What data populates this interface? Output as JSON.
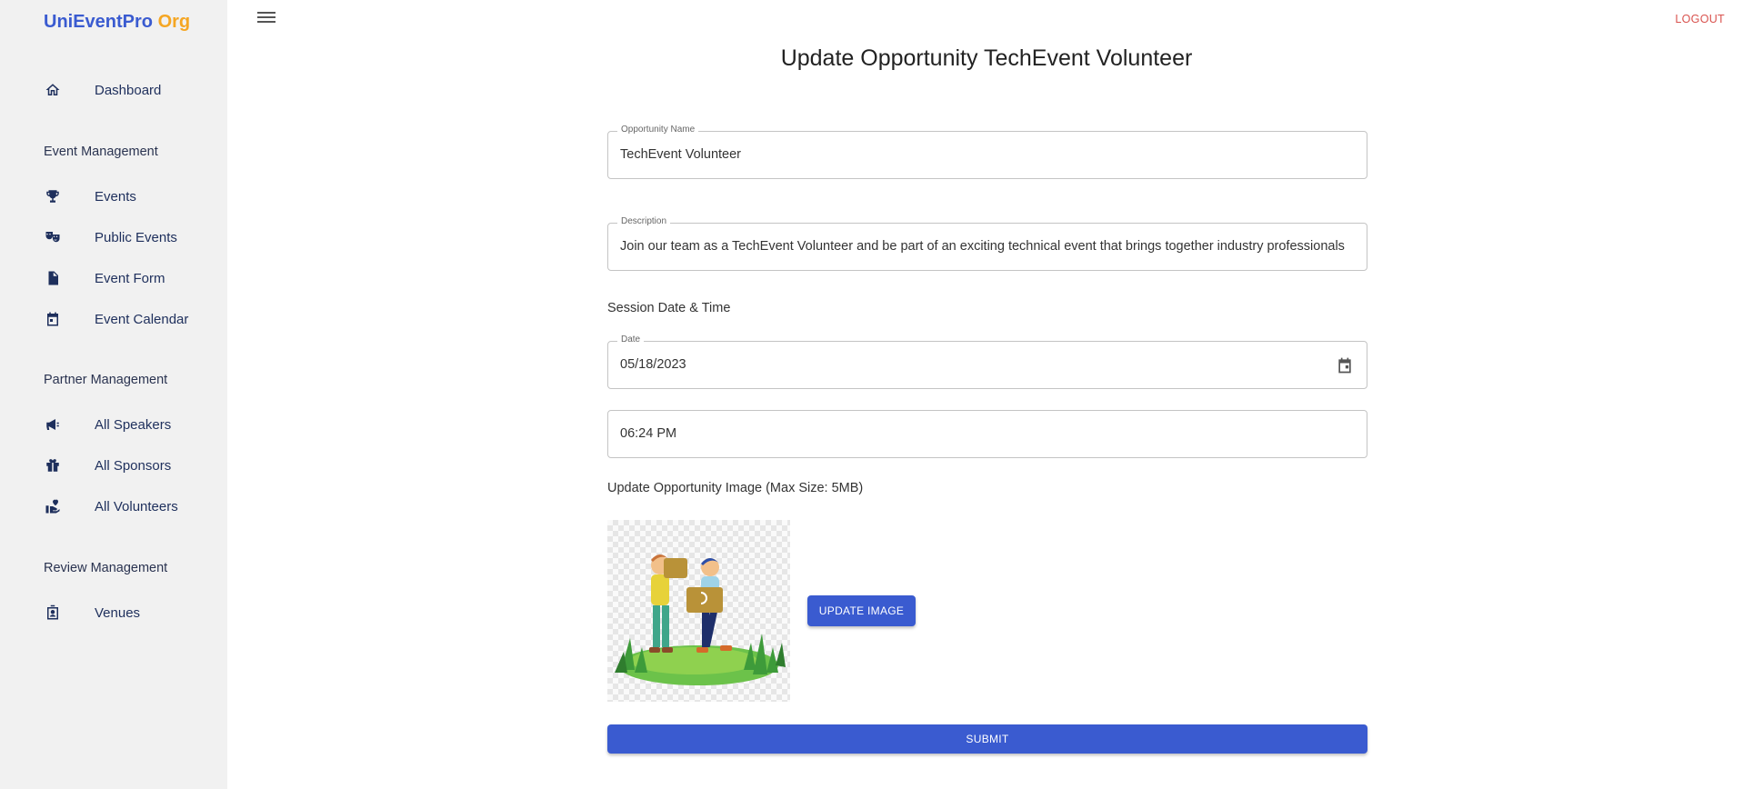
{
  "brand": {
    "name": "UniEventPro",
    "suffix": "Org",
    "primary_color": "#3a5bd0",
    "accent_color": "#f5a623"
  },
  "sidebar": {
    "items": [
      {
        "label": "Dashboard",
        "icon": "home-icon"
      },
      {
        "label": "Events",
        "icon": "trophy-icon"
      },
      {
        "label": "Public Events",
        "icon": "theater-masks-icon"
      },
      {
        "label": "Event Form",
        "icon": "document-icon"
      },
      {
        "label": "Event Calendar",
        "icon": "calendar-icon"
      },
      {
        "label": "All Speakers",
        "icon": "megaphone-icon"
      },
      {
        "label": "All Sponsors",
        "icon": "gift-box-icon"
      },
      {
        "label": "All Volunteers",
        "icon": "volunteer-hand-icon"
      },
      {
        "label": "Venues",
        "icon": "contact-badge-icon"
      }
    ],
    "sections": {
      "event": "Event Management",
      "partner": "Partner Management",
      "review": "Review Management"
    }
  },
  "header": {
    "logout_label": "LOGOUT",
    "logout_color": "#d9534f"
  },
  "main": {
    "title": "Update Opportunity TechEvent Volunteer",
    "opportunity_name": {
      "label": "Opportunity Name",
      "value": "TechEvent Volunteer"
    },
    "description": {
      "label": "Description",
      "value": "Join our team as a TechEvent Volunteer and be part of an exciting technical event that brings together industry professionals"
    },
    "session_label": "Session Date & Time",
    "date": {
      "label": "Date",
      "value": "05/18/2023"
    },
    "time": {
      "value": "06:24 PM"
    },
    "image_label": "Update Opportunity Image (Max Size: 5MB)",
    "update_image_button": "UPDATE IMAGE",
    "submit_button": "SUBMIT"
  }
}
